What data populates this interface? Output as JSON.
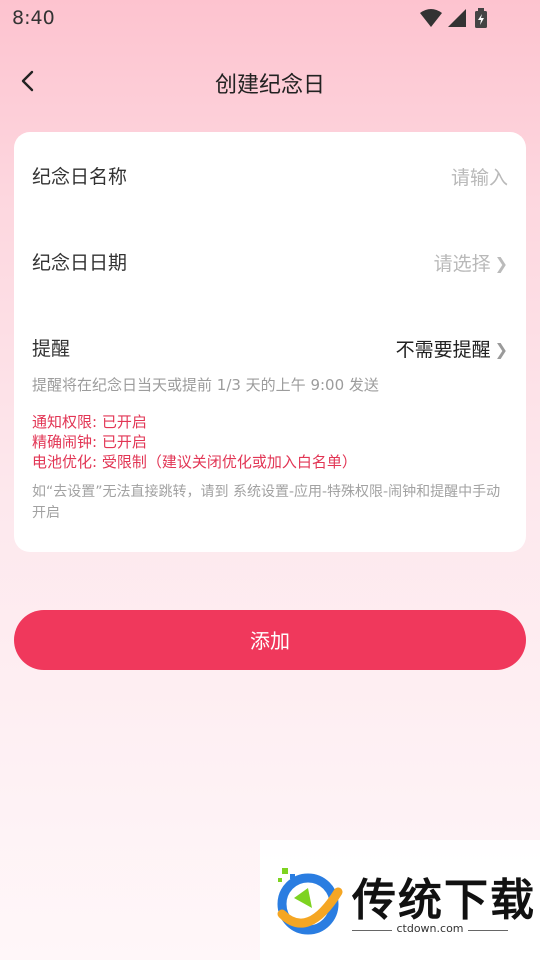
{
  "status_bar": {
    "time": "8:40",
    "icons": [
      "wifi-icon",
      "signal-icon",
      "battery-icon"
    ]
  },
  "nav": {
    "back_icon": "chevron-left-icon",
    "title": "创建纪念日"
  },
  "form": {
    "name": {
      "label": "纪念日名称",
      "placeholder": "请输入"
    },
    "date": {
      "label": "纪念日日期",
      "placeholder": "请选择"
    },
    "reminder": {
      "label": "提醒",
      "value": "不需要提醒",
      "description": "提醒将在纪念日当天或提前 1/3 天的上午 9:00 发送"
    },
    "permissions": [
      "通知权限: 已开启",
      "精确闹钟: 已开启",
      "电池优化: 受限制（建议关闭优化或加入白名单）"
    ],
    "hint": "如“去设置”无法直接跳转，请到 系统设置-应用-特殊权限-闹钟和提醒中手动开启"
  },
  "add_button": {
    "label": "添加"
  },
  "watermark": {
    "brand": "传统下载",
    "url": "ctdown.com"
  },
  "colors": {
    "accent": "#f0385c",
    "warning_text": "#e23655",
    "background_top": "#fdc3cf"
  }
}
